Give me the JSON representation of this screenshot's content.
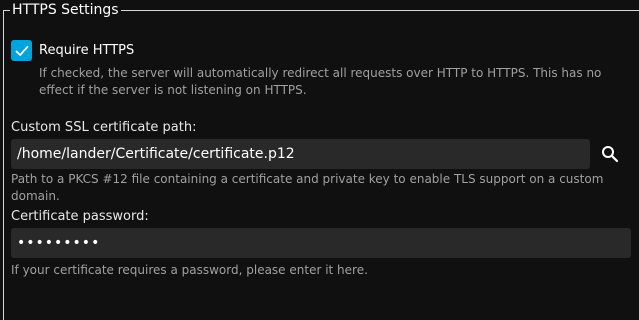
{
  "section": {
    "title": "HTTPS Settings"
  },
  "require_https": {
    "checked": true,
    "label": "Require HTTPS",
    "help": "If checked, the server will automatically redirect all requests over HTTP to HTTPS. This has no effect if the server is not listening on HTTPS."
  },
  "cert_path": {
    "label": "Custom SSL certificate path:",
    "value": "/home/lander/Certificate/certificate.p12",
    "help": "Path to a PKCS #12 file containing a certificate and private key to enable TLS support on a custom domain.",
    "icon": "search-icon"
  },
  "cert_password": {
    "label": "Certificate password:",
    "value": "•••••••••",
    "help": "If your certificate requires a password, please enter it here."
  },
  "colors": {
    "accent": "#00a4dc",
    "background": "#101010",
    "input_bg": "#292929",
    "help_text": "#a0a0a0"
  }
}
